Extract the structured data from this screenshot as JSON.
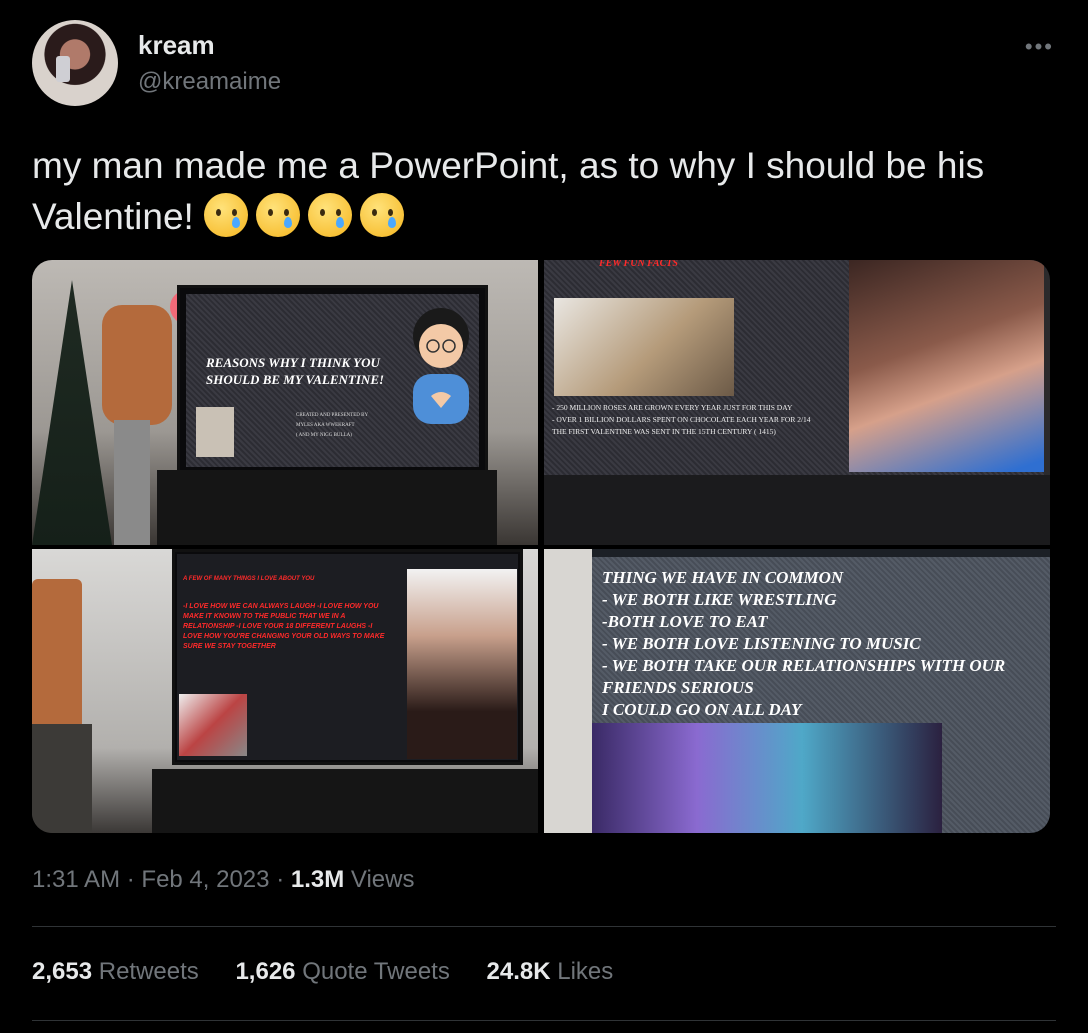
{
  "author": {
    "name": "kream",
    "handle": "@kreamaime"
  },
  "more_label": "•••",
  "tweet": {
    "text": "my man made me a PowerPoint, as to why I should be his Valentine!",
    "emoji_count": 4,
    "emoji_name": "crying-face-emoji"
  },
  "media": {
    "photo1": {
      "slide_title_1": "REASONS WHY I THINK YOU",
      "slide_title_2": "SHOULD BE MY VALENTINE!",
      "credit_1": "CREATED AND PRESENTED BY",
      "credit_2": "MYLES AKA WWEKRAFT",
      "credit_3": "( AND MY NIGG BULLA)"
    },
    "photo2": {
      "heading": "FEW FUN FACTS",
      "fact_1": "- 250 MILLION ROSES ARE GROWN EVERY YEAR JUST FOR THIS DAY",
      "fact_2": "- OVER 1 BILLION DOLLARS SPENT ON CHOCOLATE EACH YEAR FOR 2/14",
      "fact_3": "THE FIRST VALENTINE WAS SENT IN THE 15TH CENTURY ( 1415)"
    },
    "photo3": {
      "heading": "A FEW OF MANY THINGS I LOVE ABOUT YOU",
      "lines": "-I LOVE HOW WE CAN ALWAYS LAUGH -I LOVE HOW YOU MAKE IT KNOWN TO THE PUBLIC THAT WE IN A RELATIONSHIP -I LOVE YOUR 18 DIFFERENT LAUGHS -I LOVE HOW YOU'RE CHANGING YOUR OLD WAYS TO MAKE SURE WE STAY TOGETHER"
    },
    "photo4": {
      "line_1": "THING WE HAVE IN COMMON",
      "line_2": "- WE BOTH LIKE WRESTLING",
      "line_3": "-BOTH LOVE TO EAT",
      "line_4": "- WE BOTH LOVE LISTENING TO MUSIC",
      "line_5": "- WE BOTH TAKE OUR RELATIONSHIPS WITH OUR",
      "line_6": "FRIENDS SERIOUS",
      "line_7": "I COULD GO ON ALL DAY"
    }
  },
  "meta": {
    "time": "1:31 AM",
    "sep": "·",
    "date": "Feb 4, 2023",
    "views_count": "1.3M",
    "views_label": "Views"
  },
  "stats": {
    "retweets_count": "2,653",
    "retweets_label": "Retweets",
    "quotes_count": "1,626",
    "quotes_label": "Quote Tweets",
    "likes_count": "24.8K",
    "likes_label": "Likes"
  },
  "colors": {
    "background": "#000000",
    "text": "#e7e9ea",
    "secondary": "#71767b"
  }
}
